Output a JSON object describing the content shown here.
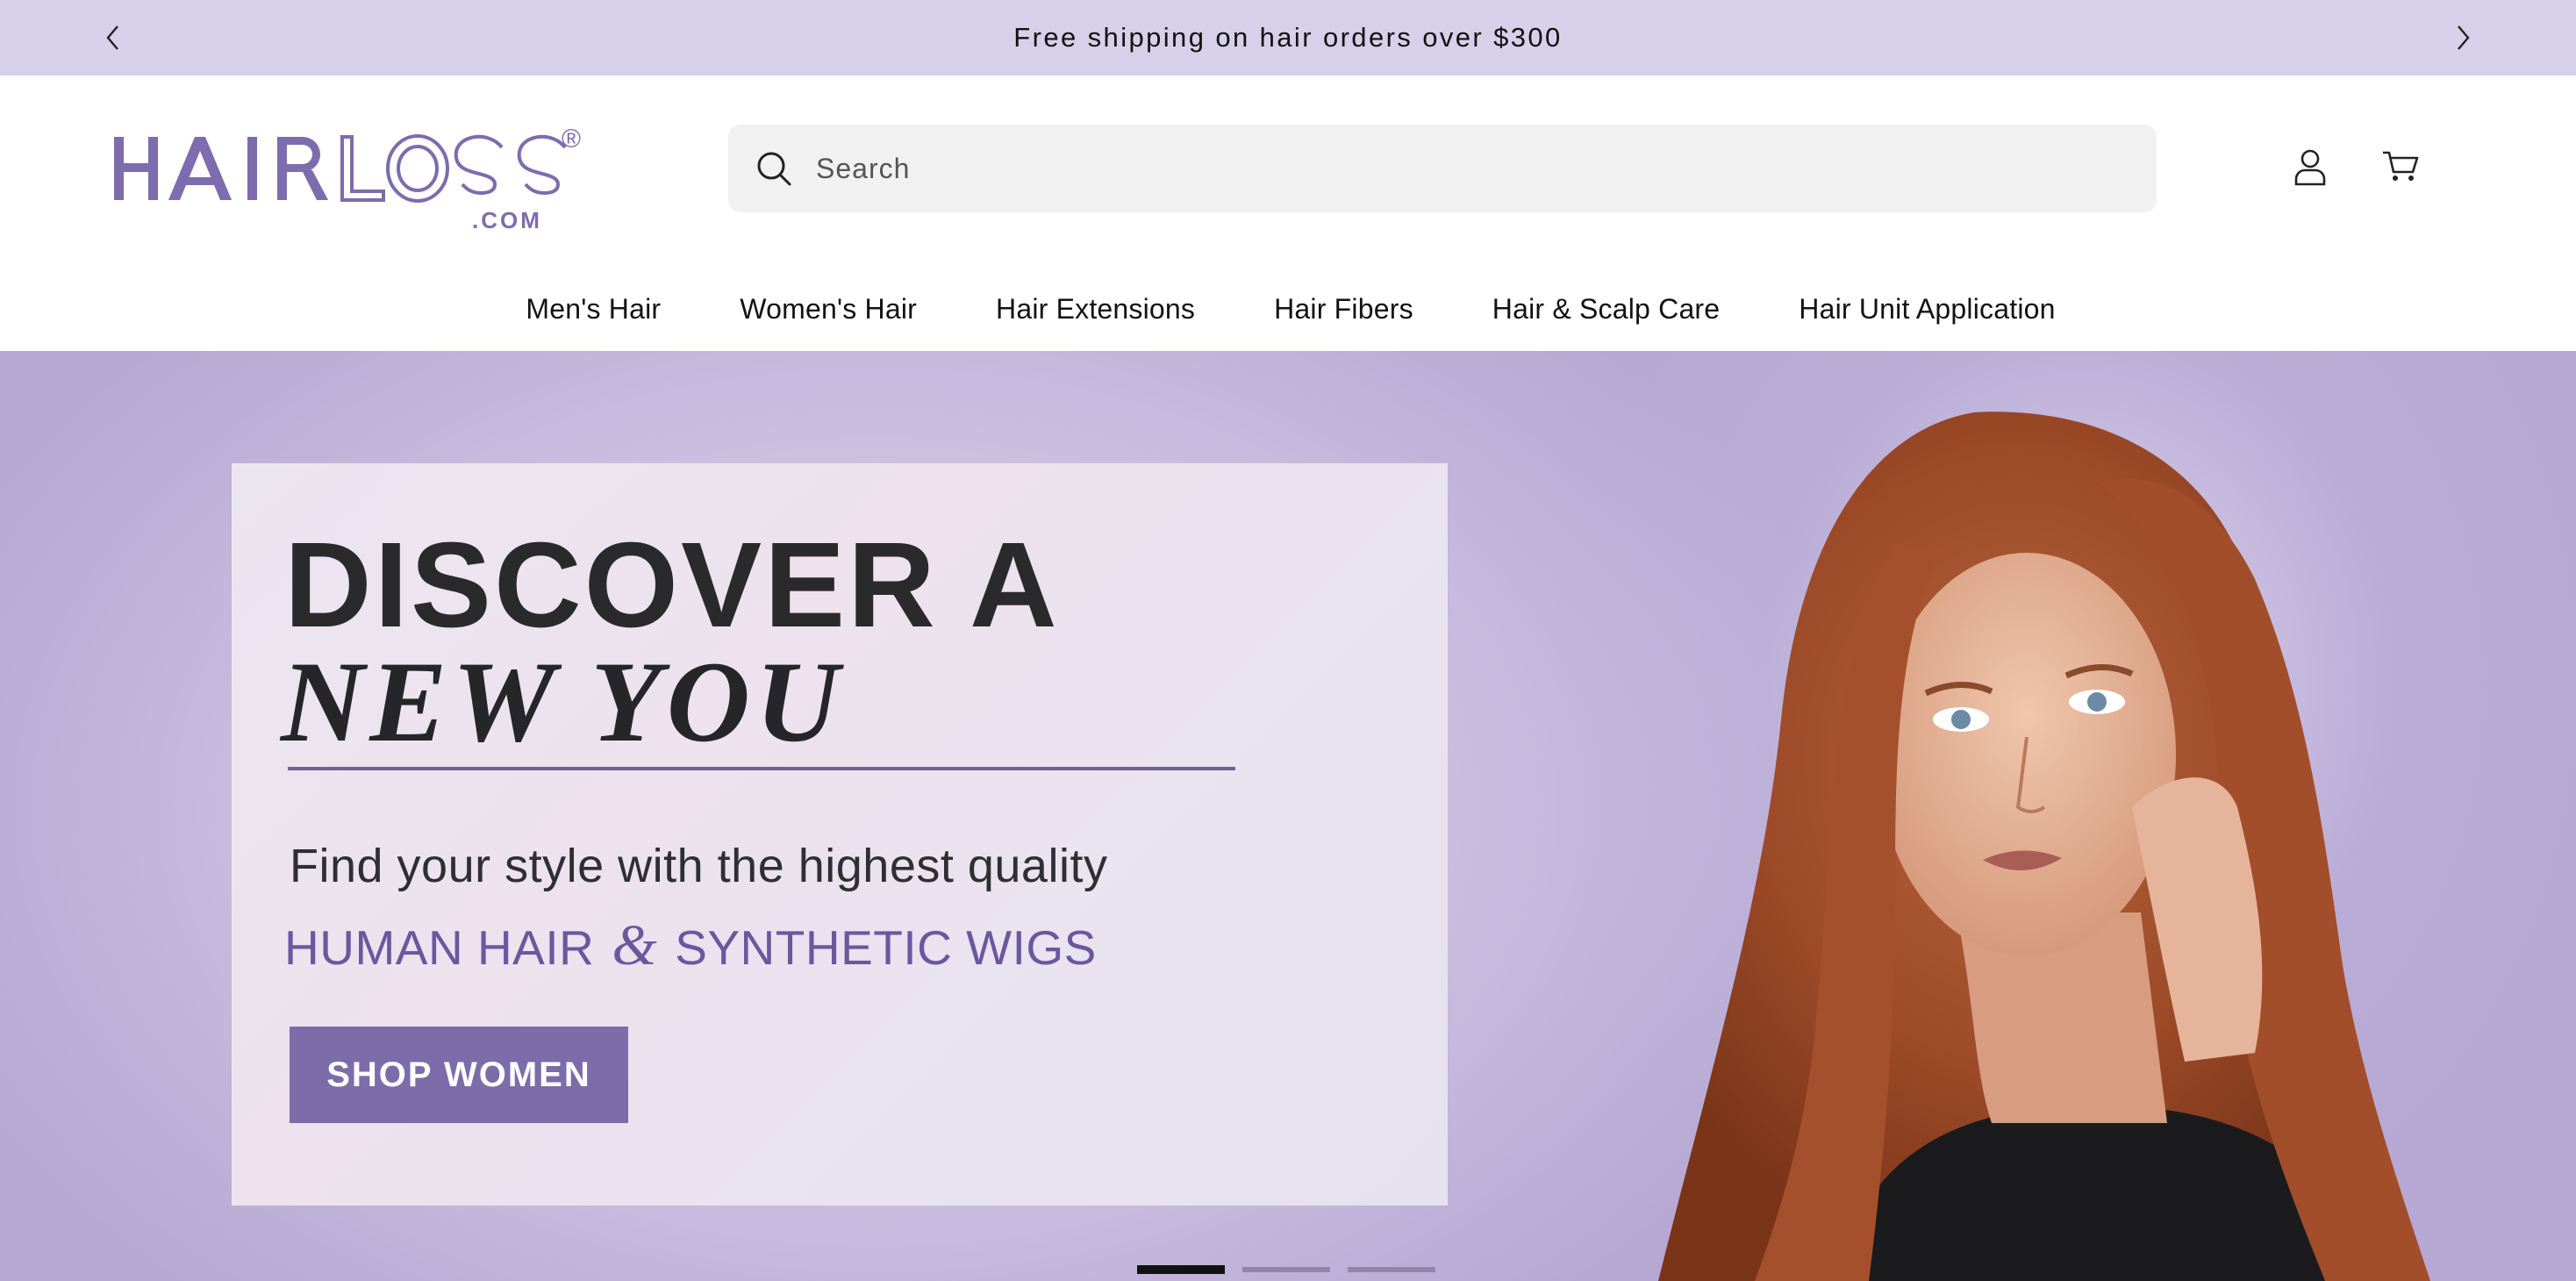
{
  "announcement": {
    "text": "Free shipping on hair orders over $300",
    "prev_icon": "chevron-left-icon",
    "next_icon": "chevron-right-icon"
  },
  "header": {
    "logo": {
      "word": "HAIRLOSS",
      "suffix": ".COM",
      "mark": "®"
    },
    "search": {
      "placeholder": "Search",
      "value": ""
    },
    "account_icon": "user-icon",
    "cart_icon": "cart-icon"
  },
  "nav": {
    "items": [
      {
        "label": "Men's Hair"
      },
      {
        "label": "Women's Hair"
      },
      {
        "label": "Hair Extensions"
      },
      {
        "label": "Hair Fibers"
      },
      {
        "label": "Hair & Scalp Care"
      },
      {
        "label": "Hair Unit Application"
      }
    ]
  },
  "hero": {
    "headline": "DISCOVER A",
    "headline_italic": "NEW YOU",
    "subtitle": "Find your style with the highest quality",
    "line2_left": "HUMAN HAIR",
    "line2_amp": "&",
    "line2_right": "SYNTHETIC WIGS",
    "cta_label": "SHOP WOMEN",
    "slides_total": 3,
    "active_slide": 1
  },
  "colors": {
    "announcement_bg": "#d6d0ea",
    "brand_purple": "#7d6cae",
    "cta_bg": "#7c6ca9",
    "search_bg": "#f1f1f1"
  }
}
